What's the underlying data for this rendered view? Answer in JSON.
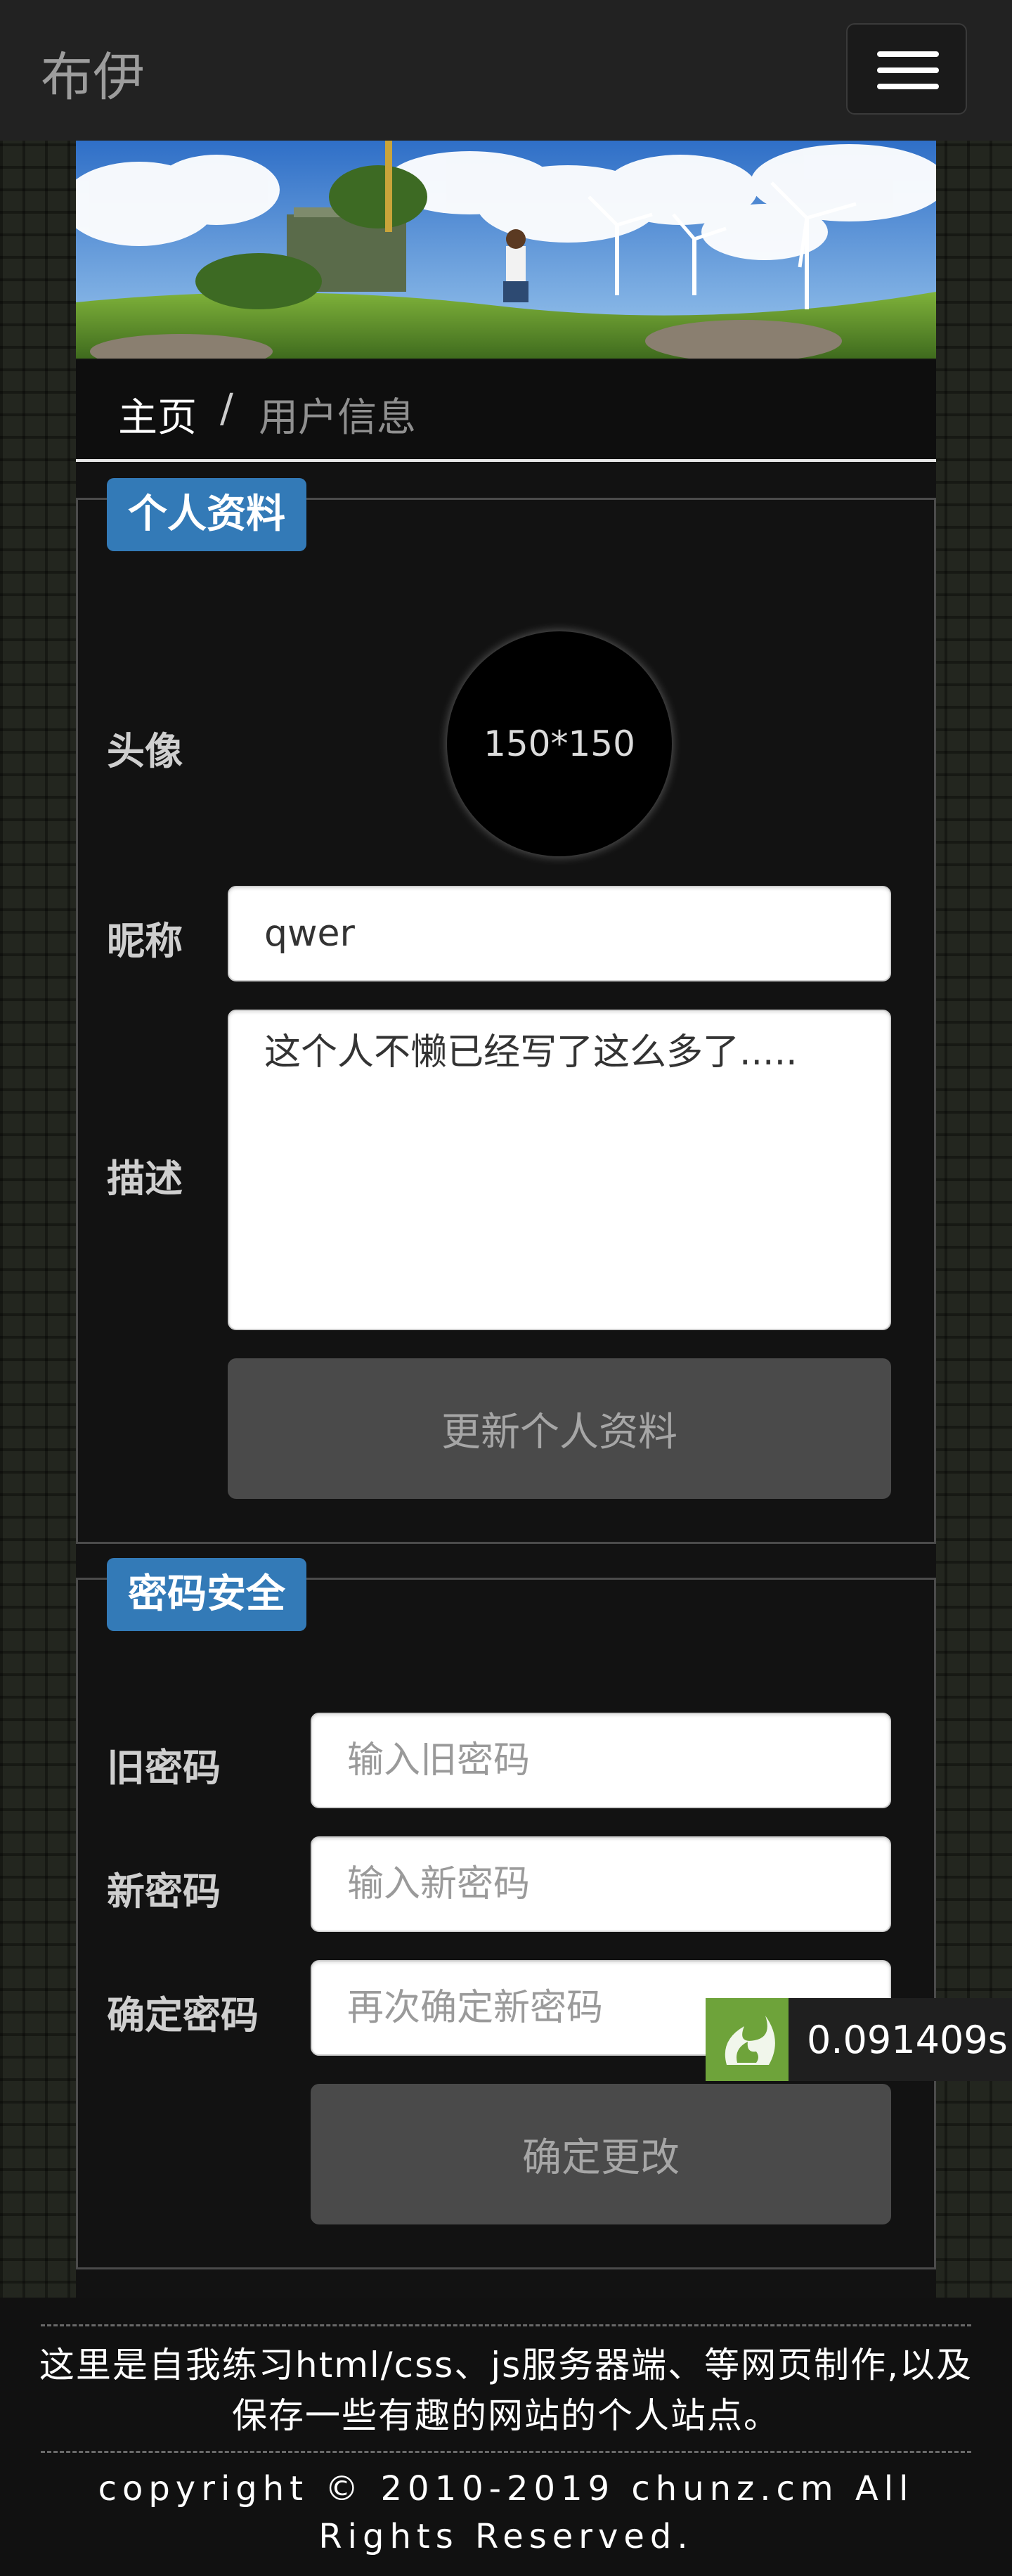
{
  "navbar": {
    "brand": "布伊",
    "menu_icon": "hamburger-icon"
  },
  "breadcrumb": {
    "home": "主页",
    "separator": "/",
    "current": "用户信息"
  },
  "profile": {
    "legend": "个人资料",
    "avatar_label": "头像",
    "avatar_text": "150*150",
    "nickname_label": "昵称",
    "nickname_value": "qwer",
    "desc_label": "描述",
    "desc_value": "这个人不懒已经写了这么多了.....",
    "submit_label": "更新个人资料"
  },
  "password": {
    "legend": "密码安全",
    "old_label": "旧密码",
    "old_placeholder": "输入旧密码",
    "new_label": "新密码",
    "new_placeholder": "输入新密码",
    "confirm_label": "确定密码",
    "confirm_placeholder": "再次确定新密码",
    "submit_label": "确定更改"
  },
  "timer": {
    "value": "0.091409s"
  },
  "footer": {
    "description": "这里是自我练习html/css、js服务器端、等网页制作,以及保存一些有趣的网站的个人站点。",
    "copyright": "copyright © 2010-2019 chunz.cm All Rights Reserved."
  },
  "colors": {
    "accent": "#337ab7",
    "navbar": "#222222",
    "button": "#4a4a4a",
    "timer_icon": "#6ea33a"
  }
}
